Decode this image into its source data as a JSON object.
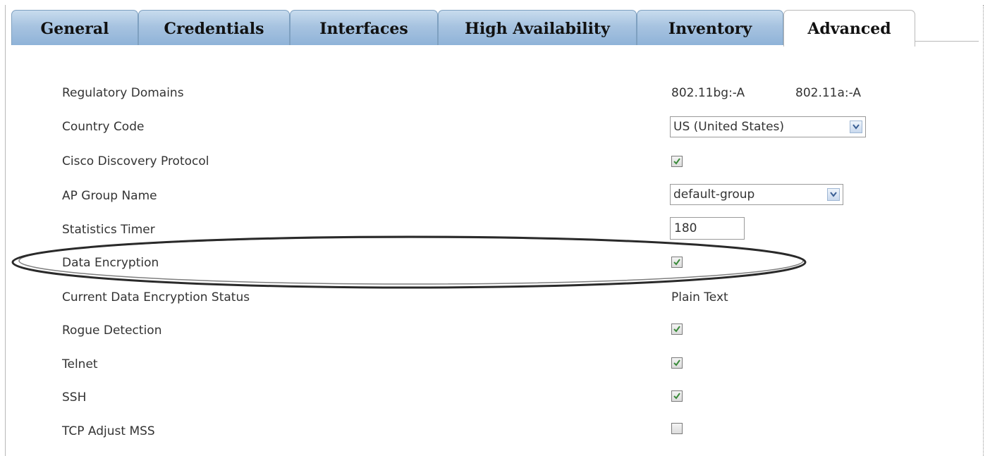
{
  "tabs": [
    {
      "label": "General",
      "active": false
    },
    {
      "label": "Credentials",
      "active": false
    },
    {
      "label": "Interfaces",
      "active": false
    },
    {
      "label": "High Availability",
      "active": false
    },
    {
      "label": "Inventory",
      "active": false
    },
    {
      "label": "Advanced",
      "active": true
    }
  ],
  "fields": {
    "regulatory_domains": {
      "label": "Regulatory Domains",
      "value_bg": "802.11bg:-A",
      "value_a": "802.11a:-A"
    },
    "country_code": {
      "label": "Country Code",
      "value": "US (United States)"
    },
    "cdp": {
      "label": "Cisco Discovery Protocol",
      "checked": true
    },
    "ap_group": {
      "label": "AP Group Name",
      "value": "default-group"
    },
    "stats_timer": {
      "label": "Statistics Timer",
      "value": "180"
    },
    "data_encryption": {
      "label": "Data Encryption",
      "checked": true
    },
    "encryption_status": {
      "label": "Current Data Encryption Status",
      "value": "Plain Text"
    },
    "rogue_detection": {
      "label": "Rogue Detection",
      "checked": true
    },
    "telnet": {
      "label": "Telnet",
      "checked": true
    },
    "ssh": {
      "label": "SSH",
      "checked": true
    },
    "tcp_mss": {
      "label": "TCP Adjust MSS",
      "checked": false
    }
  },
  "colors": {
    "tab_blue": "#a7c3e0",
    "check_green": "#3a8a3a",
    "highlight_ellipse": "#2a2a2a"
  }
}
